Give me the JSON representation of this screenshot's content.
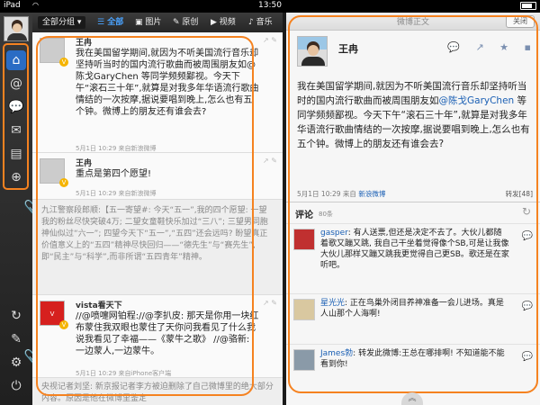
{
  "status": {
    "device": "iPad",
    "time": "13:50"
  },
  "toolbar": {
    "group_label": "全部分组",
    "tabs": [
      {
        "label": "全部",
        "icon": "list-icon"
      },
      {
        "label": "图片",
        "icon": "picture-icon"
      },
      {
        "label": "原创",
        "icon": "pen-icon"
      },
      {
        "label": "视频",
        "icon": "play-icon"
      },
      {
        "label": "音乐",
        "icon": "music-icon"
      }
    ]
  },
  "nav": {
    "items": [
      "home-icon",
      "mention-icon",
      "comment-icon",
      "mail-icon",
      "card-icon",
      "search-icon"
    ],
    "bottom": [
      "refresh-icon",
      "compose-icon",
      "settings-icon",
      "logout-icon"
    ]
  },
  "timeline": {
    "posts": [
      {
        "name": "王冉",
        "text": "我在美国留学期间,就因为不听美国流行音乐却坚持听当时的国内流行歌曲而被周围朋友如@陈戈GaryChen 等同学频频鄙视。今天下午“滚石三十年”,就算是对我多年华语流行歌曲情结的一次按摩,据说要唱到晚上,怎么也有五个钟。微博上的朋友还有谁会去?",
        "meta": "5月1日 10:29 来自新浪微博"
      },
      {
        "name": "王冉",
        "text": "重点是第四个愿望!",
        "meta": "5月1日 10:29 来自新浪微博"
      },
      {
        "name": "",
        "text": "九江警察段郎顺:【五一寄望#: 今天“五一”,我的四个愿望: 一望我的粉丝尽快突破4万; 二望女童鞋快乐加过“三八”; 三望男同胞神仙似过“六一”; 四望今天下“五一”,“五四”还会远吗? 盼望真正价值意义上的“五四”精神尽快回归——“德先生”与“赛先生”,即“民主”与“科学”,而非所谓“五四青年”精神。",
        "meta": ""
      },
      {
        "name": "vista看天下",
        "text": "//@喷嚏网铂程://@李扒皮: 那天是你用一块红布蒙住我双眼也蒙住了天你问我看见了什么我说我看见了幸福——《蒙牛之歌》 //@骆新: 一边蒙人,一边蒙牛。",
        "meta": "5月1日 10:29 来自iPhone客户端"
      },
      {
        "name": "",
        "text": "央视记者刘坚: 新京报记者李方被迫删除了自己微博里的绝大部分内容。原因是他在微博里鉴定",
        "meta": ""
      }
    ]
  },
  "detail": {
    "title": "微博正文",
    "close_label": "关闭",
    "author": "王冉",
    "text_before": "我在美国留学期间,就因为不听美国流行音乐却坚持听当时的国内流行歌曲而被周围朋友如",
    "mention": "@陈戈GaryChen",
    "text_after": " 等同学频频鄙视。今天下午“滚石三十年”,就算是对我多年华语流行歌曲情结的一次按摩,据说要唱到晚上,怎么也有五个钟。微博上的朋友还有谁会去?",
    "meta_time": "5月1日 10:29 来自",
    "meta_source": "新浪微博",
    "repost": "转发[48]",
    "comments_label": "评论",
    "comments_count": "80条",
    "comments": [
      {
        "user": "gasper",
        "text": ": 有人送票,但还是决定不去了。大伙儿都随着歌又蹦又跳, 我自己干坐着觉得像个SB,可是让我像大伙儿那样又蹦又跳我更觉得自己更SB。歌还是在家听吧。"
      },
      {
        "user": "星光光",
        "text": ": 正在鸟巢外闭目养神准备一会儿进场。真是人山那个人海啊!"
      },
      {
        "user": "James勃",
        "text": ": 转发此微博:王总在哪排啊! 不知道能不能看到你!"
      }
    ]
  }
}
